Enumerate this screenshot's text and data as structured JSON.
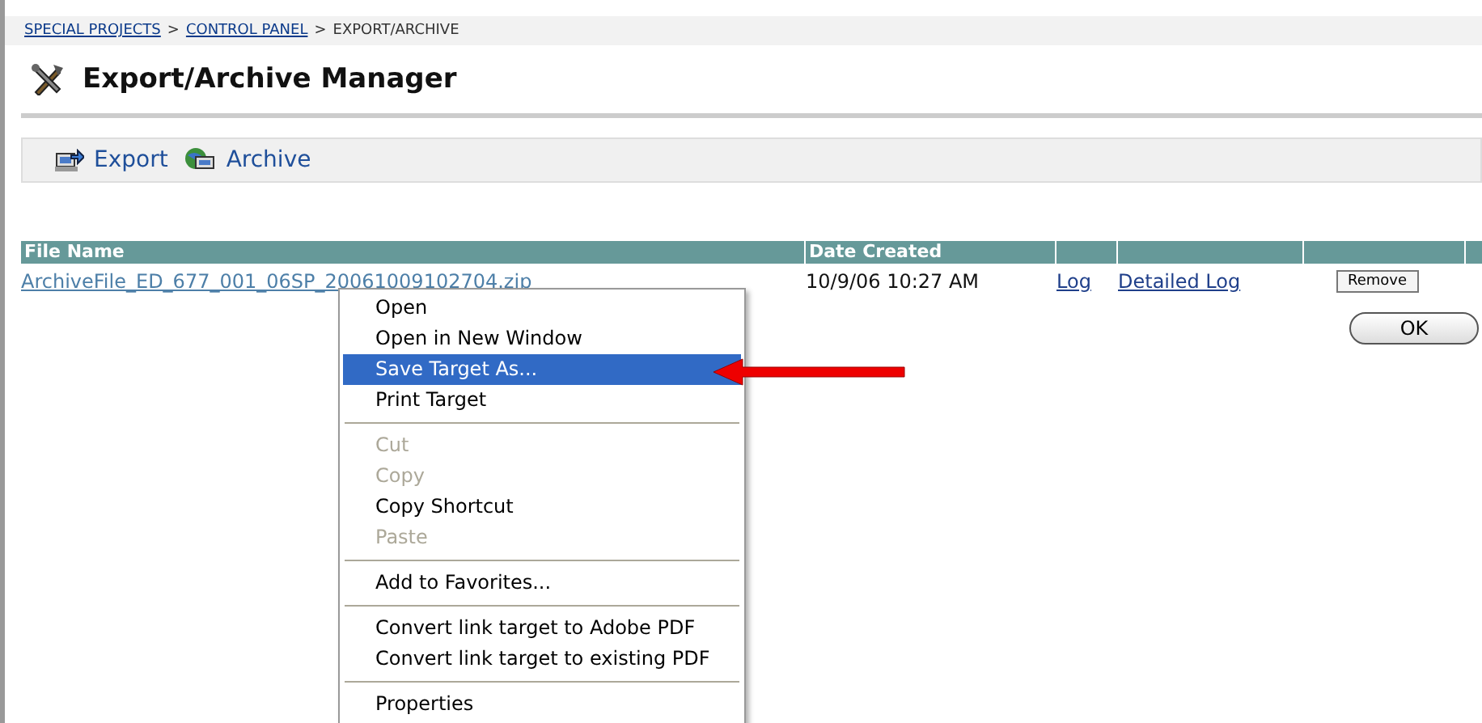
{
  "breadcrumb": [
    {
      "label": "SPECIAL PROJECTS",
      "link": true
    },
    {
      "label": "CONTROL PANEL",
      "link": true
    },
    {
      "label": "EXPORT/ARCHIVE",
      "link": false
    }
  ],
  "breadcrumb_separator": ">",
  "page_title": "Export/Archive Manager",
  "toolbar": [
    {
      "label": "Export",
      "kind": "export"
    },
    {
      "label": "Archive",
      "kind": "archive"
    }
  ],
  "table": {
    "columns": [
      "File Name",
      "Date Created"
    ],
    "rows": [
      {
        "file_name": "ArchiveFile_ED_677_001_06SP_20061009102704.zip",
        "date_created": "10/9/06 10:27 AM",
        "links": [
          "Log",
          "Detailed Log"
        ],
        "button": "Remove"
      }
    ]
  },
  "ok_button": "OK",
  "context_menu": [
    {
      "kind": "item",
      "label": "Open",
      "selected": false,
      "disabled": false
    },
    {
      "kind": "item",
      "label": "Open in New Window",
      "selected": false,
      "disabled": false
    },
    {
      "kind": "item",
      "label": "Save Target As...",
      "selected": true,
      "disabled": false
    },
    {
      "kind": "item",
      "label": "Print Target",
      "selected": false,
      "disabled": false
    },
    {
      "kind": "separator"
    },
    {
      "kind": "item",
      "label": "Cut",
      "selected": false,
      "disabled": true
    },
    {
      "kind": "item",
      "label": "Copy",
      "selected": false,
      "disabled": true
    },
    {
      "kind": "item",
      "label": "Copy Shortcut",
      "selected": false,
      "disabled": false
    },
    {
      "kind": "item",
      "label": "Paste",
      "selected": false,
      "disabled": true
    },
    {
      "kind": "separator"
    },
    {
      "kind": "item",
      "label": "Add to Favorites...",
      "selected": false,
      "disabled": false
    },
    {
      "kind": "separator"
    },
    {
      "kind": "item",
      "label": "Convert link target to Adobe PDF",
      "selected": false,
      "disabled": false
    },
    {
      "kind": "item",
      "label": "Convert link target to existing PDF",
      "selected": false,
      "disabled": false
    },
    {
      "kind": "separator"
    },
    {
      "kind": "item",
      "label": "Properties",
      "selected": false,
      "disabled": false
    }
  ]
}
